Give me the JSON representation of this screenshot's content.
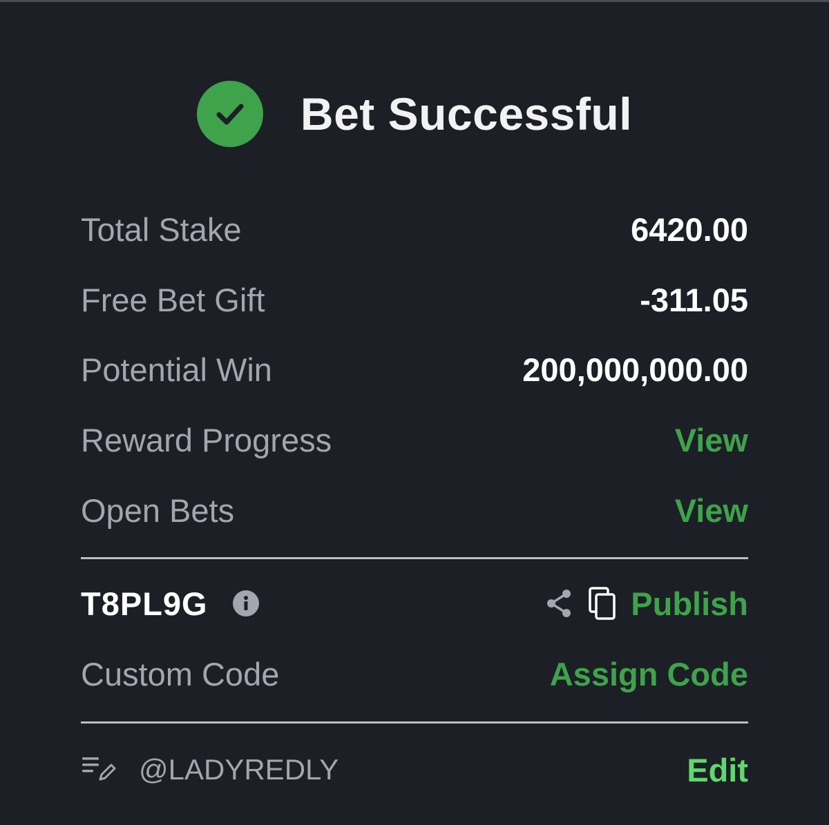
{
  "header": {
    "title": "Bet Successful",
    "icon": "check-circle-icon",
    "accent": "#3ea34a"
  },
  "summary": {
    "total_stake_label": "Total Stake",
    "total_stake_value": "6420.00",
    "free_bet_label": "Free Bet Gift",
    "free_bet_value": "-311.05",
    "potential_win_label": "Potential Win",
    "potential_win_value": "200,000,000.00",
    "reward_progress_label": "Reward Progress",
    "reward_progress_link": "View",
    "open_bets_label": "Open Bets",
    "open_bets_link": "View"
  },
  "booking": {
    "code": "T8PL9G",
    "info_icon": "info-icon",
    "share_icon": "share-icon",
    "copy_icon": "copy-icon",
    "publish_label": "Publish",
    "custom_code_label": "Custom Code",
    "assign_code_label": "Assign Code"
  },
  "footer": {
    "note_icon": "edit-list-icon",
    "username": "@LADYREDLY",
    "edit_label": "Edit"
  }
}
